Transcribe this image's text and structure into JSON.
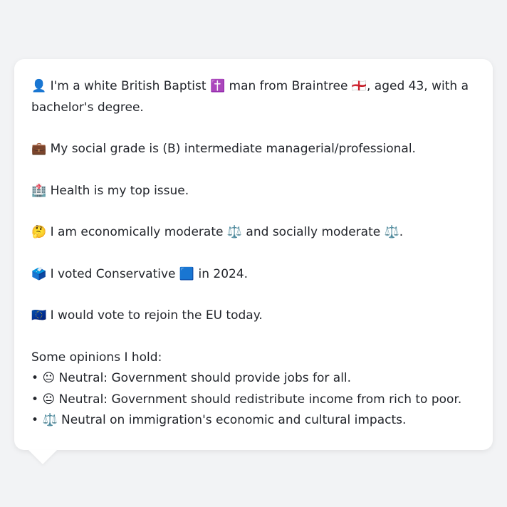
{
  "bio": {
    "identity": "👤 I'm a white British Baptist ✝️ man from Braintree 🏴󠁧󠁢󠁥󠁮󠁧󠁿, aged 43, with a bachelor's degree.",
    "social_grade": "💼 My social grade is (B) intermediate managerial/professional.",
    "top_issue": "🏥 Health is my top issue.",
    "ideology": "🤔 I am economically moderate ⚖️ and socially moderate ⚖️.",
    "vote_2024": "🗳️ I voted Conservative 🟦 in 2024.",
    "eu_stance": "🇪🇺 I would vote to rejoin the EU today."
  },
  "opinions": {
    "heading": "Some opinions I hold:",
    "items": [
      "😐 Neutral: Government should provide jobs for all.",
      "😐 Neutral: Government should redistribute income from rich to poor.",
      "⚖️ Neutral on immigration's economic and cultural impacts."
    ]
  }
}
